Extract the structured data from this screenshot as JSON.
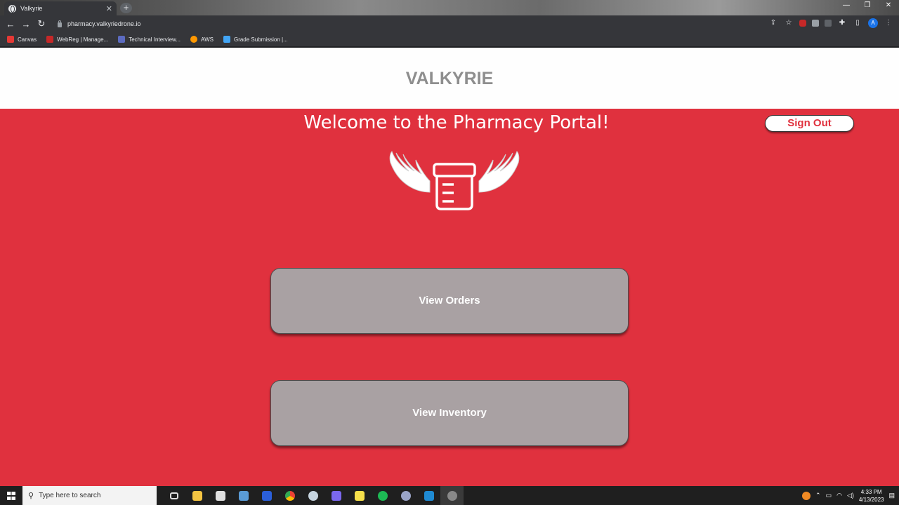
{
  "browser": {
    "tab_title": "Valkyrie",
    "tab_close": "✕",
    "new_tab": "+",
    "url": "pharmacy.valkyriedrone.io",
    "bookmarks": [
      {
        "label": "Canvas",
        "color": "#e53935"
      },
      {
        "label": "WebReg | Manage...",
        "color": "#c62828"
      },
      {
        "label": "Technical Interview...",
        "color": "#5c6bc0"
      },
      {
        "label": "AWS",
        "color": "#ff9800"
      },
      {
        "label": "Grade Submission |...",
        "color": "#42a5f5"
      }
    ],
    "window_controls": [
      "—",
      "❐",
      "✕"
    ],
    "nav": {
      "back": "←",
      "forward": "→",
      "reload": "↻"
    },
    "toolbar_icons": [
      "share-icon",
      "star-icon",
      "extension-icon",
      "extension-icon",
      "extension-icon",
      "extensions-icon",
      "sidepanel-icon"
    ],
    "profile_initial": "A",
    "menu": "⋮"
  },
  "page": {
    "brand": "VALKYRIE",
    "welcome": "Welcome to the Pharmacy Portal!",
    "sign_out_label": "Sign Out",
    "actions": {
      "view_orders": "View Orders",
      "view_inventory": "View Inventory"
    },
    "colors": {
      "primary": "#e0313e",
      "button_gray": "#a9a1a3",
      "header_bg": "#fefefe",
      "brand_text": "#8e8e8e"
    }
  },
  "taskbar": {
    "search_placeholder": "Type here to search",
    "time": "4:33 PM",
    "date": "4/13/2023"
  }
}
